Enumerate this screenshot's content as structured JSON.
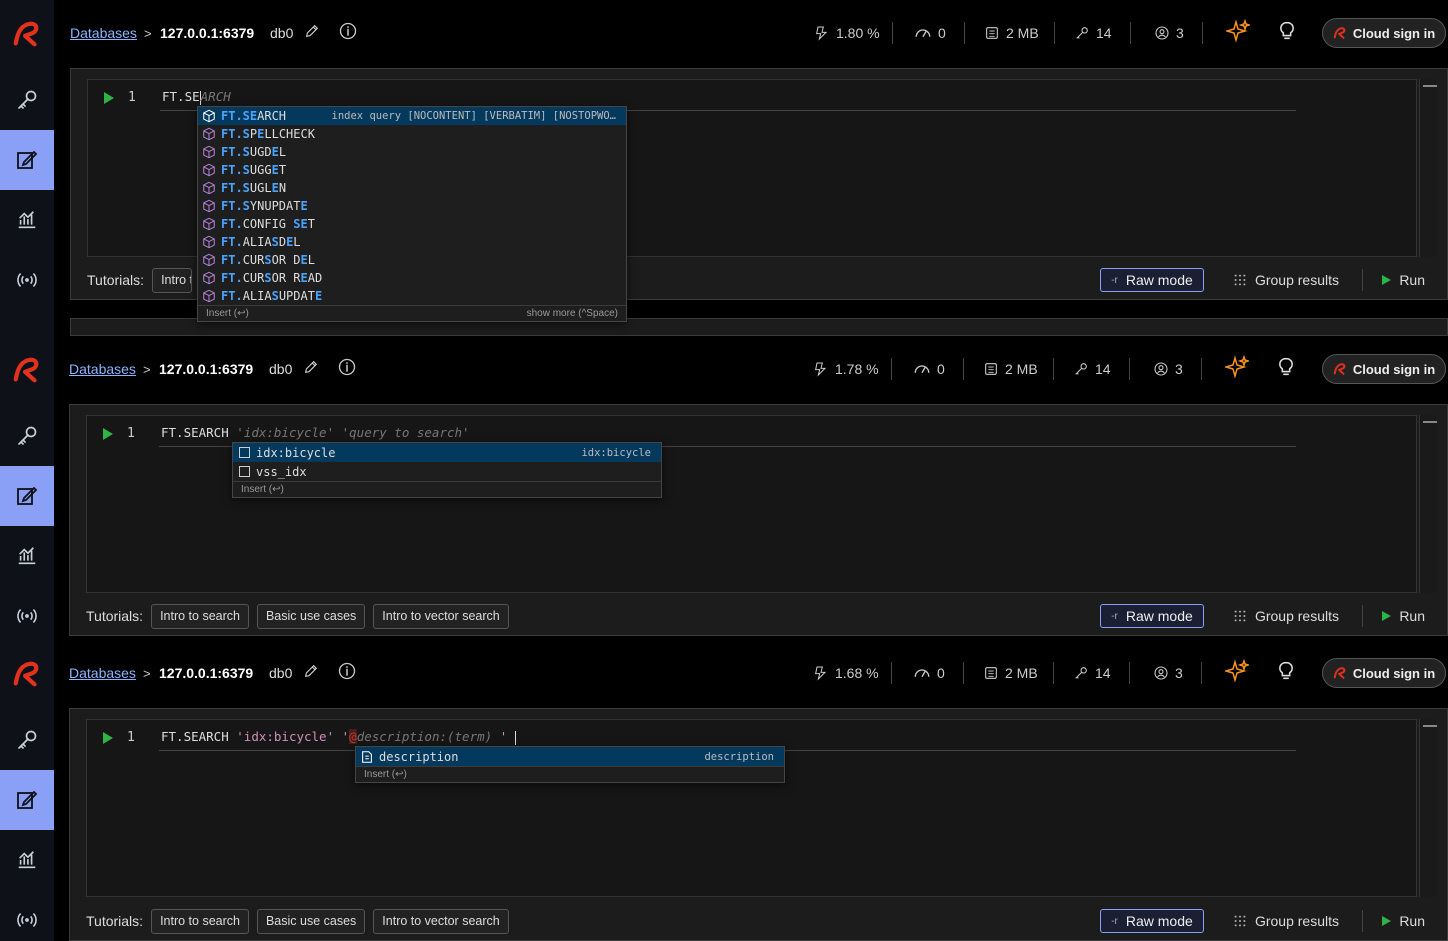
{
  "colors": {
    "accent": "#8aa0f7",
    "run_green": "#2fb344",
    "brand_red": "#e0321e",
    "sparkle": "#f7931e",
    "link": "#8ab4ff"
  },
  "breadcrumb": {
    "databases": "Databases",
    "separator": ">",
    "host": "127.0.0.1:6379",
    "db": "db0"
  },
  "stat_icons": [
    "cpu-icon",
    "speed-icon",
    "memory-icon",
    "keys-icon",
    "clients-icon"
  ],
  "cloud_sign_in": "Cloud sign in",
  "tutorials_label": "Tutorials:",
  "tutorials": [
    "Intro to search",
    "Basic use cases",
    "Intro to vector search"
  ],
  "raw_mode": {
    "tag": "-r",
    "label": "Raw mode"
  },
  "group_results": "Group results",
  "run": "Run",
  "sections": [
    {
      "stats": {
        "cpu": "1.80 %",
        "ops": "0",
        "memory": "2 MB",
        "keys": "14",
        "clients": "3"
      },
      "line_number": "1",
      "code_typed": "FT.SE",
      "code_ghost": "ARCH",
      "tutorial_visible": "Intro t",
      "autocomplete": {
        "items": [
          {
            "label": "FT.SEARCH",
            "detail": "index query [NOCONTENT] [VERBATIM] [NOSTOPWO…"
          },
          {
            "label": "FT.SPELLCHECK",
            "detail": ""
          },
          {
            "label": "FT.SUGDEL",
            "detail": ""
          },
          {
            "label": "FT.SUGGET",
            "detail": ""
          },
          {
            "label": "FT.SUGLEN",
            "detail": ""
          },
          {
            "label": "FT.SYNUPDATE",
            "detail": ""
          },
          {
            "label": "FT.CONFIG SET",
            "detail": ""
          },
          {
            "label": "FT.ALIASDEL",
            "detail": ""
          },
          {
            "label": "FT.CURSOR DEL",
            "detail": ""
          },
          {
            "label": "FT.CURSOR READ",
            "detail": ""
          },
          {
            "label": "FT.ALIASUPDATE",
            "detail": ""
          }
        ],
        "footer_left": "Insert (↩)",
        "footer_right": "show more (^Space)"
      }
    },
    {
      "stats": {
        "cpu": "1.78 %",
        "ops": "0",
        "memory": "2 MB",
        "keys": "14",
        "clients": "3"
      },
      "line_number": "1",
      "code_cmd": "FT.SEARCH ",
      "code_ghost": "'idx:bicycle' 'query to search'",
      "autocomplete": {
        "items": [
          {
            "label": "idx:bicycle",
            "detail": "idx:bicycle"
          },
          {
            "label": "vss_idx",
            "detail": ""
          }
        ],
        "footer_left": "Insert (↩)"
      }
    },
    {
      "stats": {
        "cpu": "1.68 %",
        "ops": "0",
        "memory": "2 MB",
        "keys": "14",
        "clients": "3"
      },
      "line_number": "1",
      "code_cmd": "FT.SEARCH ",
      "code_str1": "'idx:bicycle'",
      "code_str2": " '",
      "code_at": "@",
      "code_ghost": "description:(term) ",
      "code_tail": "'",
      "autocomplete": {
        "items": [
          {
            "label": "description",
            "detail": "description"
          }
        ],
        "footer_left": "Insert (↩)"
      }
    }
  ]
}
